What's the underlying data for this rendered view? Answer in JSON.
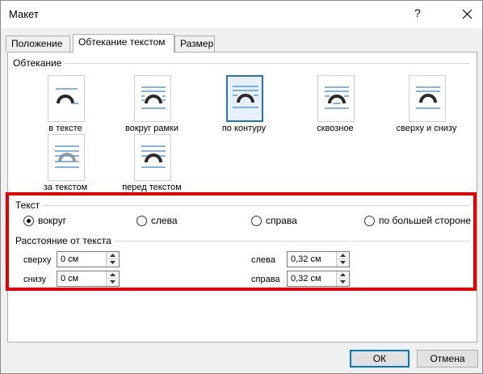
{
  "window": {
    "title": "Макет",
    "help_label": "?"
  },
  "tabs": [
    {
      "label": "Положение",
      "active": false
    },
    {
      "label": "Обтекание текстом",
      "active": true
    },
    {
      "label": "Размер",
      "active": false
    }
  ],
  "wrapping": {
    "group_label": "Обтекание",
    "options": [
      {
        "label": "в тексте",
        "icon": "inline-with-text-icon",
        "selected": false
      },
      {
        "label": "вокруг рамки",
        "icon": "wrap-square-icon",
        "selected": false
      },
      {
        "label": "по контуру",
        "icon": "wrap-tight-icon",
        "selected": true
      },
      {
        "label": "сквозное",
        "icon": "wrap-through-icon",
        "selected": false
      },
      {
        "label": "сверху и снизу",
        "icon": "wrap-top-bottom-icon",
        "selected": false
      },
      {
        "label": "за текстом",
        "icon": "behind-text-icon",
        "selected": false
      },
      {
        "label": "перед текстом",
        "icon": "in-front-of-text-icon",
        "selected": false
      }
    ]
  },
  "text_wrap": {
    "group_label": "Текст",
    "options": [
      {
        "label": "вокруг",
        "checked": true
      },
      {
        "label": "слева",
        "checked": false
      },
      {
        "label": "справа",
        "checked": false
      },
      {
        "label": "по большей стороне",
        "checked": false
      }
    ]
  },
  "distance": {
    "group_label": "Расстояние от текста",
    "top": {
      "label": "сверху",
      "value": "0 см"
    },
    "bottom": {
      "label": "снизу",
      "value": "0 см"
    },
    "left": {
      "label": "слева",
      "value": "0,32 см"
    },
    "right": {
      "label": "справа",
      "value": "0,32 см"
    }
  },
  "buttons": {
    "ok_label": "ОК",
    "cancel_label": "Отмена"
  },
  "colors": {
    "highlight_frame": "#e80000",
    "selected_border": "#2b6fbf",
    "icon_lines": "#5b9bd5",
    "icon_shape": "#2b2b2b"
  }
}
